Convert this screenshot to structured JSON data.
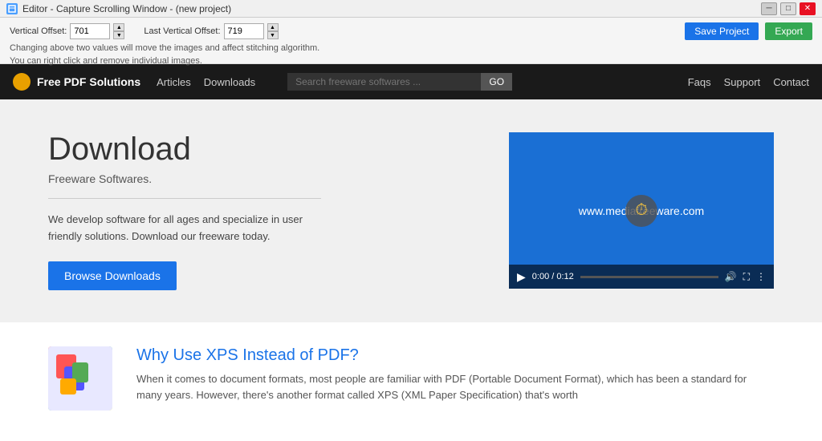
{
  "titlebar": {
    "title": "Editor - Capture Scrolling Window - (new project)",
    "icon": "E"
  },
  "toolbar": {
    "vertical_offset_label": "Vertical Offset:",
    "vertical_offset_value": "701",
    "last_vertical_offset_label": "Last Vertical Offset:",
    "last_vertical_offset_value": "719",
    "info_line1": "Changing above two values will move the images and affect stitching algorithm.",
    "info_line2": "You can right click and remove individual images.",
    "save_button": "Save Project",
    "export_button": "Export"
  },
  "nav": {
    "logo_text": "Free PDF Solutions",
    "links": [
      "Articles",
      "Downloads"
    ],
    "search_placeholder": "Search freeware softwares ...",
    "search_button": "GO",
    "right_links": [
      "Faqs",
      "Support",
      "Contact"
    ]
  },
  "hero": {
    "title": "Download",
    "subtitle": "Freeware Softwares.",
    "description": "We develop software for all ages and specialize in user friendly solutions. Download our freeware today.",
    "browse_button": "Browse Downloads",
    "video_url_text": "www.mediafreeware.com",
    "video_time": "0:00 / 0:12"
  },
  "article": {
    "title": "Why Use XPS Instead of PDF?",
    "body": "When it comes to document formats, most people are familiar with PDF (Portable Document Format), which has been a standard for many years. However, there's another format called XPS (XML Paper Specification) that's worth"
  }
}
